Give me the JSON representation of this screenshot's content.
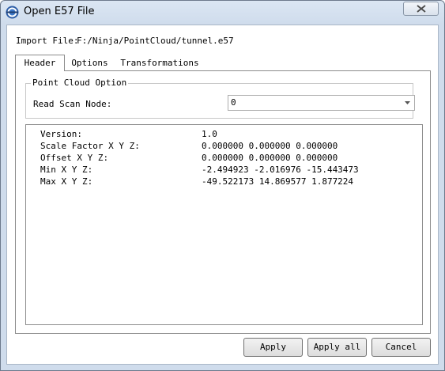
{
  "window": {
    "title": "Open E57 File"
  },
  "import_file": {
    "label": "Import File:",
    "path": "F:/Ninja/PointCloud/tunnel.e57"
  },
  "tabs": [
    {
      "label": "Header",
      "active": true
    },
    {
      "label": "Options",
      "active": false
    },
    {
      "label": "Transformations",
      "active": false
    }
  ],
  "point_cloud_option": {
    "group_title": "Point Cloud Option",
    "read_scan_node_label": "Read Scan Node:",
    "read_scan_node_value": "0"
  },
  "header_info": {
    "rows": [
      {
        "label": "Version:",
        "value": "1.0"
      },
      {
        "label": "Scale Factor X Y Z:",
        "value": "0.000000 0.000000 0.000000"
      },
      {
        "label": "Offset X Y Z:",
        "value": "0.000000 0.000000 0.000000"
      },
      {
        "label": "Min X Y Z:",
        "value": "-2.494923 -2.016976 -15.443473"
      },
      {
        "label": "Max X Y Z:",
        "value": "-49.522173 14.869577 1.877224"
      }
    ]
  },
  "buttons": {
    "apply": "Apply",
    "apply_all": "Apply all",
    "cancel": "Cancel"
  },
  "colors": {
    "titlebar": "#dbe6f3",
    "border": "#8c8c8c"
  }
}
